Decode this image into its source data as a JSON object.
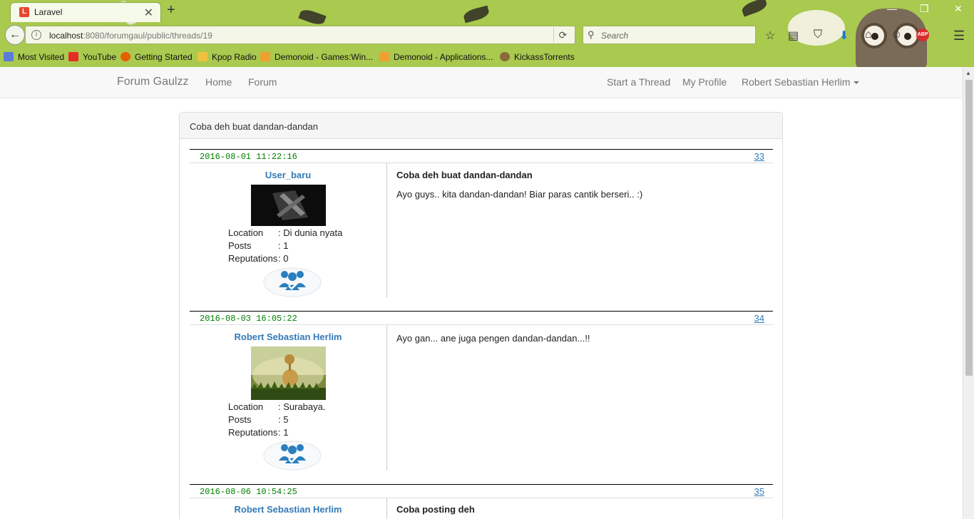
{
  "browser": {
    "tab_title": "Laravel",
    "url_host": "localhost",
    "url_rest": ":8080/forumgaul/public/threads/19",
    "search_placeholder": "Search",
    "bookmarks": [
      {
        "label": "Most Visited",
        "color": "#5a7bd6"
      },
      {
        "label": "YouTube",
        "color": "#e52d27"
      },
      {
        "label": "Getting Started",
        "color": "#e66000"
      },
      {
        "label": "Kpop Radio",
        "color": "#f0c040"
      },
      {
        "label": "Demonoid - Games:Win...",
        "color": "#f0a030"
      },
      {
        "label": "Demonoid - Applications...",
        "color": "#f0a030"
      },
      {
        "label": "KickassTorrents",
        "color": "#8a6a3a"
      }
    ]
  },
  "site": {
    "brand": "Forum Gaulzz",
    "nav_left": [
      "Home",
      "Forum"
    ],
    "nav_right": [
      "Start a Thread",
      "My Profile"
    ],
    "user_menu": "Robert Sebastian Herlim"
  },
  "thread": {
    "heading": "Coba deh buat dandan-dandan",
    "labels": {
      "location": "Location",
      "posts": "Posts",
      "reputations": "Reputations"
    },
    "posts": [
      {
        "date": "2016-08-01 11:22:16",
        "number": "33",
        "user": "User_baru",
        "location": ": Di dunia nyata",
        "posts": ": 1",
        "reputations": ": 0",
        "title": "Coba deh buat dandan-dandan",
        "body": "Ayo guys.. kita dandan-dandan! Biar paras cantik berseri.. :)"
      },
      {
        "date": "2016-08-03 16:05:22",
        "number": "34",
        "user": "Robert Sebastian Herlim",
        "location": ": Surabaya.",
        "posts": ": 5",
        "reputations": ": 1",
        "title": "",
        "body": "Ayo gan... ane juga pengen dandan-dandan...!!"
      },
      {
        "date": "2016-08-06 10:54:25",
        "number": "35",
        "user": "Robert Sebastian Herlim",
        "title": "Coba posting deh"
      }
    ]
  },
  "colors": {
    "link": "#337ab7",
    "date": "#008000",
    "chrome": "#a9c94f"
  }
}
